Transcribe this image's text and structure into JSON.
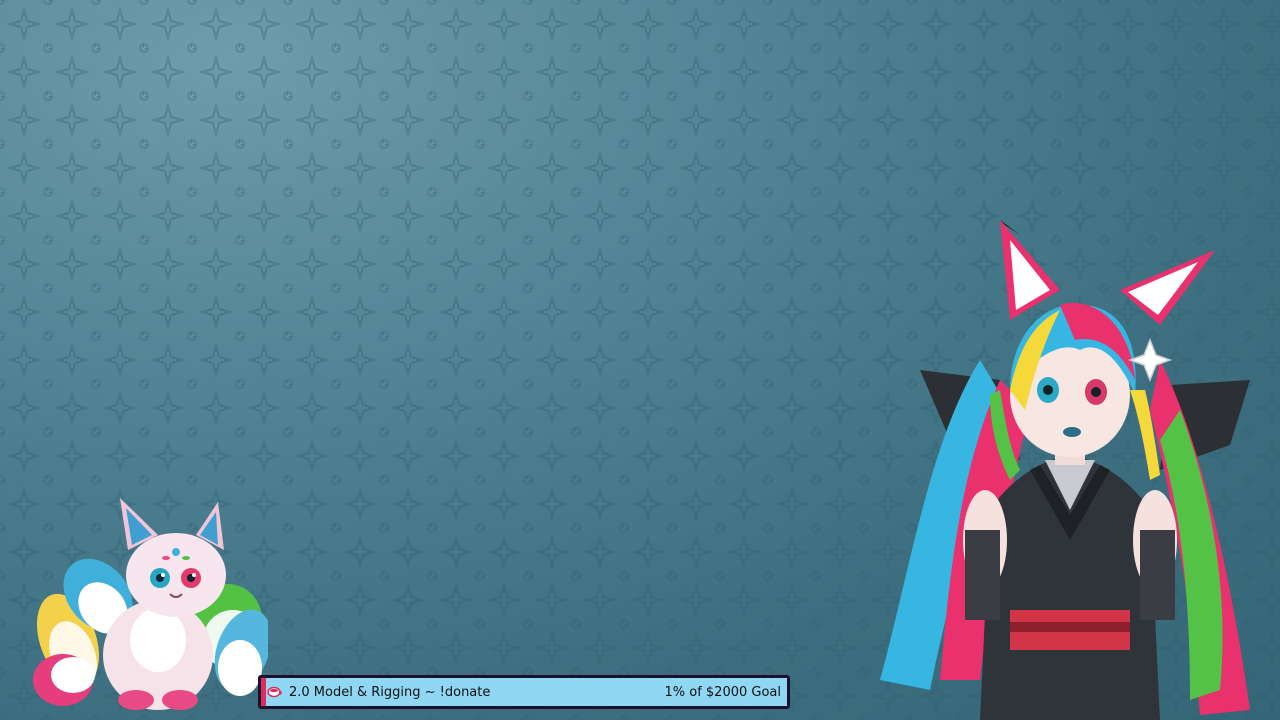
{
  "overlay": {
    "background_color": "#4a7c8c",
    "goal": {
      "title": "2.0 Model & Rigging ~ !donate",
      "progress_text": "1% of $2000 Goal",
      "progress_fraction": 0.01,
      "fill_color": "#e02b5e",
      "bar_color": "#8fd7f2",
      "icon": "coffee-cup-icon"
    },
    "characters": {
      "pet": "fox-pet-mascot",
      "avatar": "fox-girl-vtuber-avatar"
    }
  }
}
